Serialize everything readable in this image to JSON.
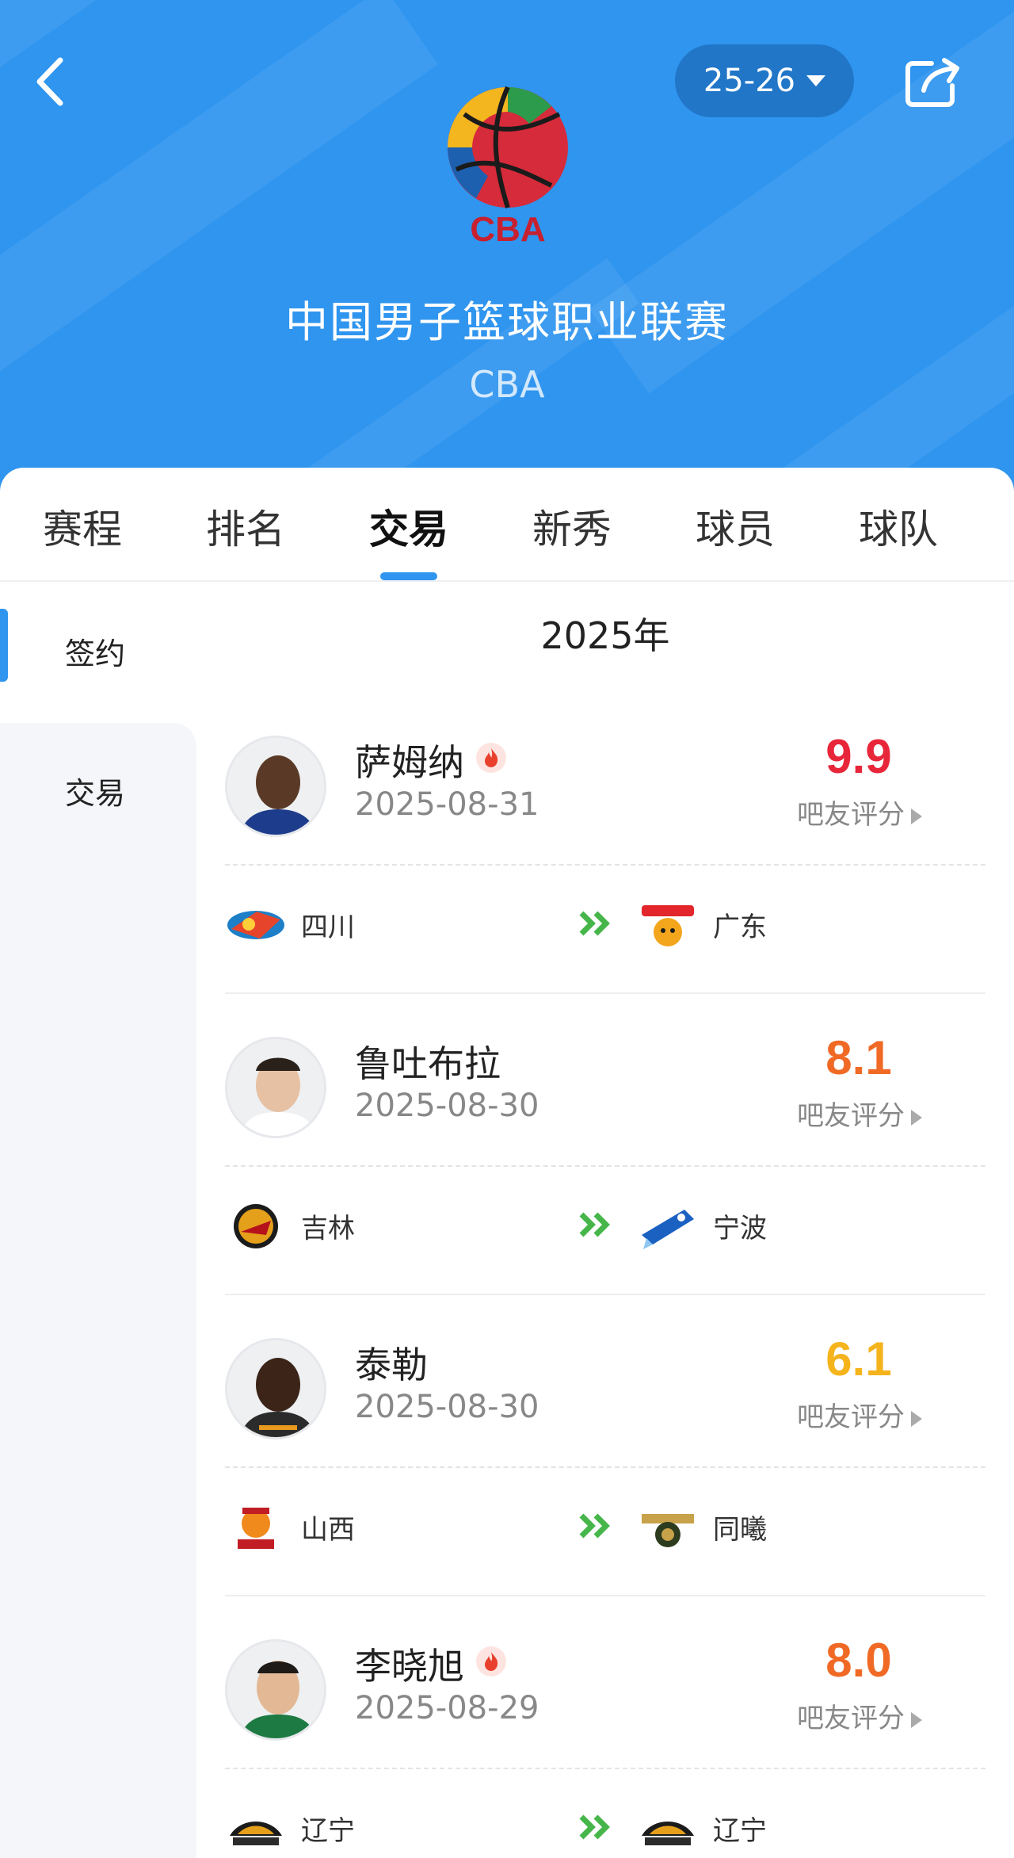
{
  "header": {
    "season": "25-26",
    "league_name": "中国男子篮球职业联赛",
    "league_abbr": "CBA",
    "logo_text": "CBA"
  },
  "tabs": [
    {
      "label": "赛程"
    },
    {
      "label": "排名"
    },
    {
      "label": "交易",
      "active": true
    },
    {
      "label": "新秀"
    },
    {
      "label": "球员"
    },
    {
      "label": "球队"
    }
  ],
  "sidebar": {
    "items": [
      {
        "label": "签约",
        "active": true
      },
      {
        "label": "交易"
      }
    ]
  },
  "list": {
    "year": "2025年",
    "score_label": "吧友评分",
    "entries": [
      {
        "name": "萨姆纳",
        "hot": true,
        "date": "2025-08-31",
        "score": "9.9",
        "score_color": "#e8263a",
        "from": "四川",
        "to": "广东"
      },
      {
        "name": "鲁吐布拉",
        "hot": false,
        "date": "2025-08-30",
        "score": "8.1",
        "score_color": "#f06a26",
        "from": "吉林",
        "to": "宁波"
      },
      {
        "name": "泰勒",
        "hot": false,
        "date": "2025-08-30",
        "score": "6.1",
        "score_color": "#f5b31c",
        "from": "山西",
        "to": "同曦"
      },
      {
        "name": "李晓旭",
        "hot": true,
        "date": "2025-08-29",
        "score": "8.0",
        "score_color": "#f06a26",
        "from": "辽宁",
        "to": "辽宁"
      }
    ]
  },
  "colors": {
    "header_bg": "#2f95ef",
    "accent": "#2f95ef",
    "arrow": "#46b64a",
    "hot": "#e8402c"
  }
}
